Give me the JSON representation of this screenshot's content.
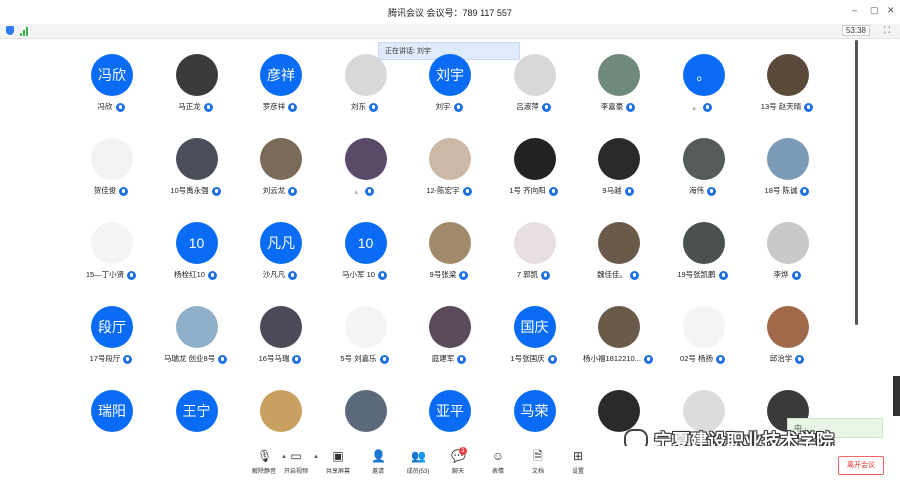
{
  "window": {
    "title": "腾讯会议 会议号：789 117 557"
  },
  "status": {
    "timer": "53:38"
  },
  "speaking": {
    "label": "正在讲话: 刘宇"
  },
  "participants": [
    {
      "name": "冯欣",
      "avatar_text": "冯欣",
      "avatar_color": "#0a6cf5"
    },
    {
      "name": "马正龙",
      "avatar_text": "",
      "avatar_color": "#3a3a3a"
    },
    {
      "name": "罗彦祥",
      "avatar_text": "彦祥",
      "avatar_color": "#0a6cf5"
    },
    {
      "name": "刘东",
      "avatar_text": "",
      "avatar_color": "#d8d8d8"
    },
    {
      "name": "刘宇",
      "avatar_text": "刘宇",
      "avatar_color": "#0a6cf5"
    },
    {
      "name": "吕淑萍",
      "avatar_text": "",
      "avatar_color": "#d8d8d8"
    },
    {
      "name": "李嘉豪",
      "avatar_text": "",
      "avatar_color": "#6f8a7a"
    },
    {
      "name": "。",
      "avatar_text": "。",
      "avatar_color": "#0a6cf5"
    },
    {
      "name": "13号 赵天晴",
      "avatar_text": "",
      "avatar_color": "#5a4a3a"
    },
    {
      "name": "贺佳俊",
      "avatar_text": "",
      "avatar_color": "#f2f2f2"
    },
    {
      "name": "10号禹永强",
      "avatar_text": "",
      "avatar_color": "#4a4e5a"
    },
    {
      "name": "刘云龙",
      "avatar_text": "",
      "avatar_color": "#7a6a5a"
    },
    {
      "name": "。",
      "avatar_text": "",
      "avatar_color": "#5a4a6a"
    },
    {
      "name": "12-陈宏宇",
      "avatar_text": "",
      "avatar_color": "#cbb9a6"
    },
    {
      "name": "1号 齐向阳",
      "avatar_text": "",
      "avatar_color": "#222222"
    },
    {
      "name": "9马越",
      "avatar_text": "",
      "avatar_color": "#2a2a2a"
    },
    {
      "name": "海伟",
      "avatar_text": "",
      "avatar_color": "#555a5a"
    },
    {
      "name": "18号 陈诚",
      "avatar_text": "",
      "avatar_color": "#7a9ab5"
    },
    {
      "name": "15—丁小贤",
      "avatar_text": "",
      "avatar_color": "#f4f4f4"
    },
    {
      "name": "杨栓红10",
      "avatar_text": "10",
      "avatar_color": "#0a6cf5"
    },
    {
      "name": "沙凡凡",
      "avatar_text": "凡凡",
      "avatar_color": "#0a6cf5"
    },
    {
      "name": "马小军 10",
      "avatar_text": "10",
      "avatar_color": "#0a6cf5"
    },
    {
      "name": "9号张梁",
      "avatar_text": "",
      "avatar_color": "#a08a6a"
    },
    {
      "name": "7 郭凯",
      "avatar_text": "",
      "avatar_color": "#e8e0e0"
    },
    {
      "name": "魏佳佳。",
      "avatar_text": "",
      "avatar_color": "#6a5a4a"
    },
    {
      "name": "19号张凯鹏",
      "avatar_text": "",
      "avatar_color": "#4a5050"
    },
    {
      "name": "李烨",
      "avatar_text": "",
      "avatar_color": "#c8c8c8"
    },
    {
      "name": "17号段厅",
      "avatar_text": "段厅",
      "avatar_color": "#0a6cf5"
    },
    {
      "name": "马瑞龙 创业8号",
      "avatar_text": "",
      "avatar_color": "#8fb0c8"
    },
    {
      "name": "16号马瑞",
      "avatar_text": "",
      "avatar_color": "#4a4a5a"
    },
    {
      "name": "5号 刘嘉乐",
      "avatar_text": "",
      "avatar_color": "#f4f4f4"
    },
    {
      "name": "庭建军",
      "avatar_text": "",
      "avatar_color": "#5a4a5a"
    },
    {
      "name": "1号张国庆",
      "avatar_text": "国庆",
      "avatar_color": "#0a6cf5"
    },
    {
      "name": "杨小福1812210...",
      "avatar_text": "",
      "avatar_color": "#6a5a4a"
    },
    {
      "name": "02号 杨扬",
      "avatar_text": "",
      "avatar_color": "#f4f4f4"
    },
    {
      "name": "邱治学",
      "avatar_text": "",
      "avatar_color": "#a06a4a"
    },
    {
      "name": "",
      "avatar_text": "瑞阳",
      "avatar_color": "#0a6cf5"
    },
    {
      "name": "",
      "avatar_text": "王宁",
      "avatar_color": "#0a6cf5"
    },
    {
      "name": "",
      "avatar_text": "",
      "avatar_color": "#c8a060"
    },
    {
      "name": "",
      "avatar_text": "",
      "avatar_color": "#5a6a7a"
    },
    {
      "name": "",
      "avatar_text": "亚平",
      "avatar_color": "#0a6cf5"
    },
    {
      "name": "",
      "avatar_text": "马荣",
      "avatar_color": "#0a6cf5"
    },
    {
      "name": "",
      "avatar_text": "",
      "avatar_color": "#2a2a2a"
    },
    {
      "name": "",
      "avatar_text": "",
      "avatar_color": "#dcdcdc"
    },
    {
      "name": "",
      "avatar_text": "",
      "avatar_color": "#3a3a3a"
    }
  ],
  "toolbar": {
    "mute": "解除静音",
    "video": "开启视频",
    "share": "共享屏幕",
    "invite": "邀请",
    "members": "成员(53)",
    "chat": "聊天",
    "chat_badge": "1",
    "emoji": "表情",
    "docs": "文档",
    "settings": "设置"
  },
  "leave": {
    "label": "离开会议"
  },
  "ime": {
    "label": "中 ·"
  },
  "watermark": {
    "text": "宁夏建设职业技术学院"
  }
}
